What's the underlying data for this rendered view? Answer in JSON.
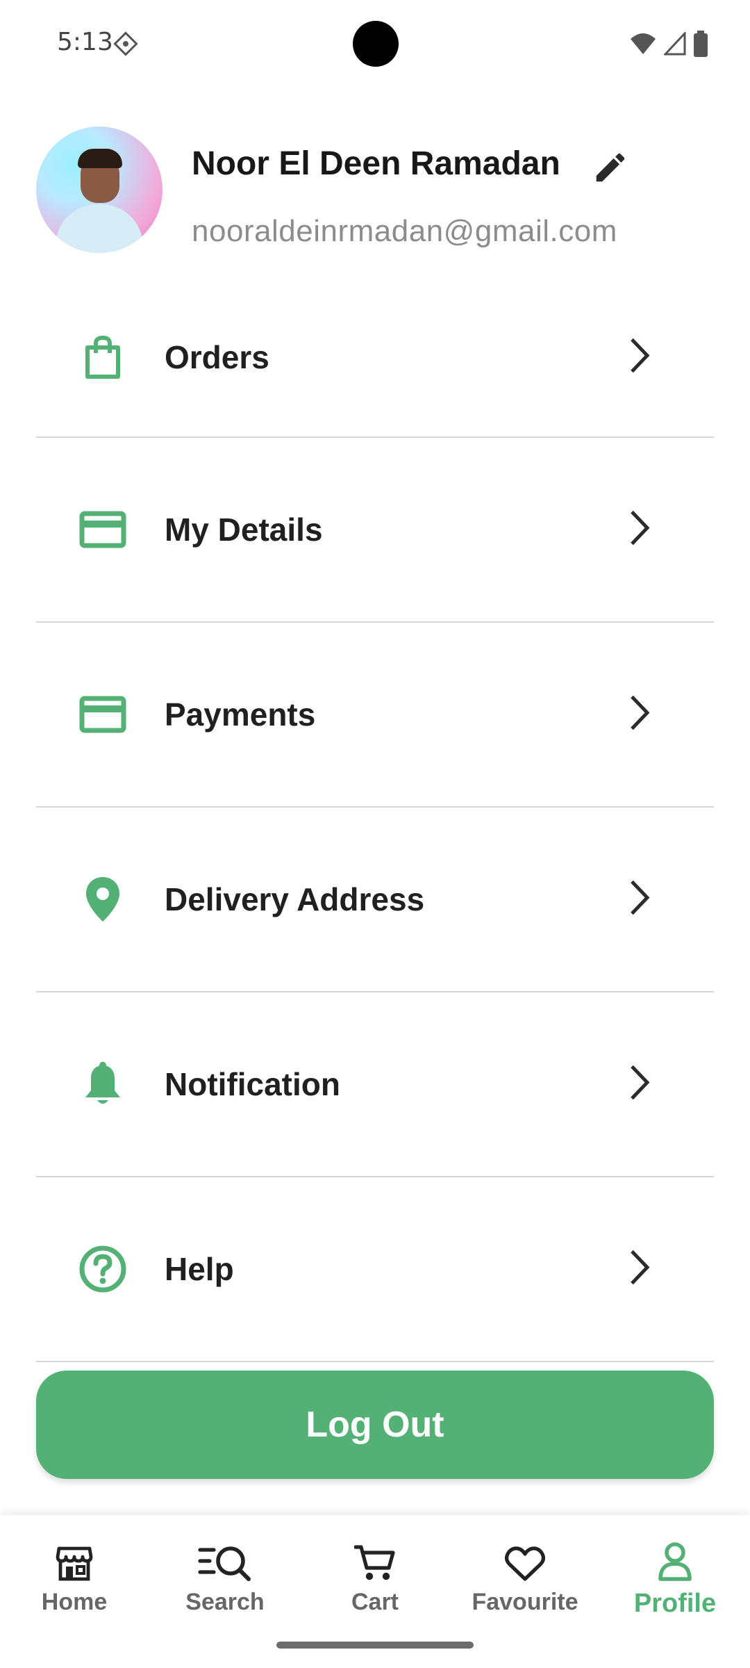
{
  "status_bar": {
    "time": "5:13"
  },
  "profile": {
    "name": "Noor El Deen Ramadan",
    "email": "nooraldeinrmadan@gmail.com"
  },
  "menu": {
    "items": [
      {
        "label": "Orders",
        "icon": "shopping-bag-icon"
      },
      {
        "label": "My Details",
        "icon": "card-icon"
      },
      {
        "label": "Payments",
        "icon": "card-icon"
      },
      {
        "label": "Delivery Address",
        "icon": "location-pin-icon"
      },
      {
        "label": "Notification",
        "icon": "bell-icon"
      },
      {
        "label": "Help",
        "icon": "help-icon"
      }
    ]
  },
  "logout_label": "Log Out",
  "nav": {
    "items": [
      {
        "label": "Home",
        "icon": "store-icon"
      },
      {
        "label": "Search",
        "icon": "search-icon"
      },
      {
        "label": "Cart",
        "icon": "cart-icon"
      },
      {
        "label": "Favourite",
        "icon": "heart-icon"
      },
      {
        "label": "Profile",
        "icon": "profile-icon",
        "active": true
      }
    ]
  },
  "colors": {
    "accent": "#53b175",
    "divider": "#d5d5dc",
    "text": "#202020",
    "muted": "#8c8c8c"
  }
}
